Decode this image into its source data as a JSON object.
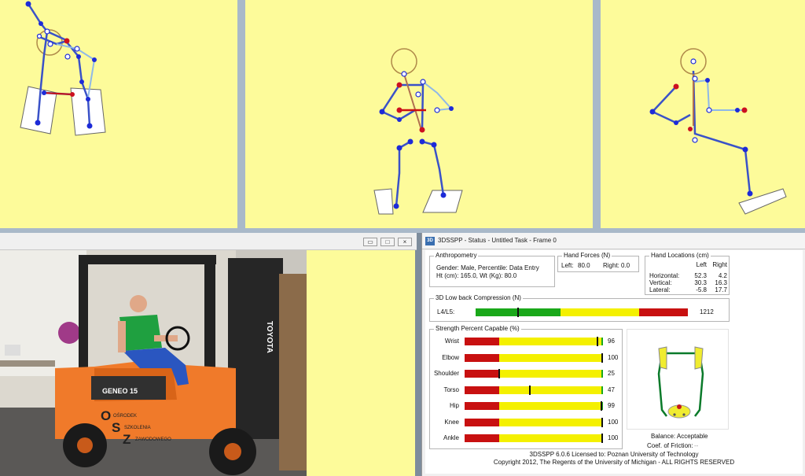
{
  "status_window": {
    "title": "3DSSPP - Status - Untitled Task - Frame 0",
    "icon": "3D",
    "anthropometry": {
      "caption": "Anthropometry",
      "line1": "Gender: Male, Percentile: Data Entry",
      "line2": "Ht (cm): 165.0, Wt (Kg): 80.0"
    },
    "hand_forces": {
      "caption": "Hand Forces (N)",
      "left_label": "Left:",
      "left_value": "80.0",
      "right_label": "Right:",
      "right_value": "0.0"
    },
    "hand_locations": {
      "caption": "Hand Locations (cm)",
      "col_left": "Left",
      "col_right": "Right",
      "rows": [
        {
          "label": "Horizontal:",
          "left": "52.3",
          "right": "4.2"
        },
        {
          "label": "Vertical:",
          "left": "30.3",
          "right": "16.3"
        },
        {
          "label": "Lateral:",
          "left": "-5.8",
          "right": "17.7"
        }
      ]
    },
    "low_back": {
      "caption": "3D Low back Compression (N)",
      "label": "L4/L5:",
      "value": "1212",
      "level": 0.2
    },
    "strength": {
      "caption": "Strength Percent Capable (%)",
      "rows": [
        {
          "label": "Wrist",
          "value": "96",
          "pct": 96
        },
        {
          "label": "Elbow",
          "value": "100",
          "pct": 100
        },
        {
          "label": "Shoulder",
          "value": "25",
          "pct": 25
        },
        {
          "label": "Torso",
          "value": "47",
          "pct": 47
        },
        {
          "label": "Hip",
          "value": "99",
          "pct": 99
        },
        {
          "label": "Knee",
          "value": "100",
          "pct": 100
        },
        {
          "label": "Ankle",
          "value": "100",
          "pct": 100
        }
      ]
    },
    "balance": "Balance: Acceptable",
    "friction": "Coef. of Friction:",
    "friction_value": "--",
    "license": "3DSSPP 6.0.6 Licensed to:  Poznan University of Technology",
    "copyright": "Copyright 2012, The Regents of the University of Michigan - ALL RIGHTS RESERVED"
  },
  "photo": {
    "forklift_model": "GENEO 15",
    "mast_brand": "TOYOTA",
    "side_text": [
      "OŚRODEK",
      "SZKOLENIA",
      "ZAWODOWEGO"
    ],
    "side_initials": [
      "O",
      "S",
      "Z"
    ]
  },
  "colors": {
    "pane_bg": "#fdfb9a",
    "bone": "#3a52c8",
    "joint": "#1d2bd8",
    "force": "#cc1010",
    "bar_red": "#c81010",
    "bar_yellow": "#f4f000",
    "bar_green": "#1aa81a"
  }
}
